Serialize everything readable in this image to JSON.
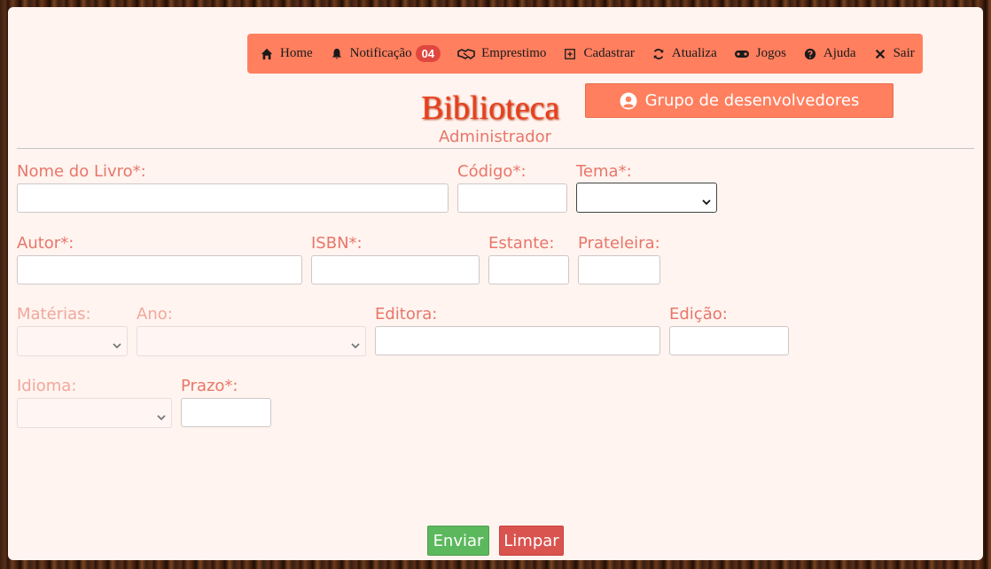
{
  "nav": {
    "items": [
      {
        "label": "Home",
        "icon": "home-icon"
      },
      {
        "label": "Notificação",
        "icon": "bell-icon",
        "badge": "04"
      },
      {
        "label": "Emprestimo",
        "icon": "handshake-icon"
      },
      {
        "label": "Cadastrar",
        "icon": "plus-square-icon"
      },
      {
        "label": "Atualiza",
        "icon": "refresh-icon"
      },
      {
        "label": "Jogos",
        "icon": "gamepad-icon"
      },
      {
        "label": "Ajuda",
        "icon": "question-circle-icon"
      },
      {
        "label": "Sair",
        "icon": "close-icon"
      }
    ]
  },
  "header": {
    "title": "Biblioteca",
    "subtitle": "Administrador",
    "dev_button_label": "Grupo de desenvolvedores"
  },
  "form": {
    "nome_livro": {
      "label": "Nome do Livro*:",
      "value": ""
    },
    "codigo": {
      "label": "Código*:",
      "value": ""
    },
    "tema": {
      "label": "Tema*:",
      "selected": ""
    },
    "autor": {
      "label": "Autor*:",
      "value": ""
    },
    "isbn": {
      "label": "ISBN*:",
      "value": ""
    },
    "estante": {
      "label": "Estante:",
      "value": ""
    },
    "prateleira": {
      "label": "Prateleira:",
      "value": ""
    },
    "materias": {
      "label": "Matérias:",
      "selected": ""
    },
    "ano": {
      "label": "Ano:",
      "selected": ""
    },
    "editora": {
      "label": "Editora:",
      "value": ""
    },
    "edicao": {
      "label": "Edição:",
      "value": ""
    },
    "idioma": {
      "label": "Idioma:",
      "selected": ""
    },
    "prazo": {
      "label": "Prazo*:",
      "value": ""
    }
  },
  "actions": {
    "send_label": "Enviar",
    "clear_label": "Limpar"
  },
  "colors": {
    "navbar": "#ff7f5f",
    "title": "#e8401c",
    "label": "#e8766a",
    "send": "#5cb85c",
    "clear": "#d9534f",
    "badge": "#e0473e"
  }
}
